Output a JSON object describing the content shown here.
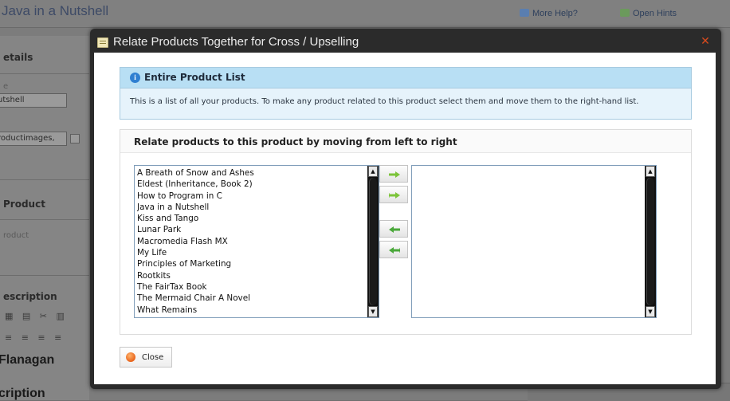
{
  "background": {
    "page_title": "Java in a Nutshell",
    "more_help": "More Help?",
    "open_hints": "Open Hints",
    "details_heading": "etails",
    "field_label_1": "e",
    "field_value_1": "utshell",
    "field_value_2": "roductimages,",
    "product_heading": "Product",
    "product_text": "roduct",
    "description_heading": "escription",
    "author_text": "Flanagan",
    "description_text": "cription"
  },
  "modal": {
    "title": "Relate Products Together for Cross / Upselling",
    "info": {
      "title": "Entire Product List",
      "text": "This is a list of all your products. To make any product related to this product select them and move them to the right-hand list."
    },
    "relate": {
      "title": "Relate products to this product by moving from left to right",
      "available_products": [
        "A Breath of Snow and Ashes",
        "Eldest (Inheritance, Book 2)",
        "How to Program in C",
        "Java in a Nutshell",
        "Kiss and Tango",
        "Lunar Park",
        "Macromedia Flash MX",
        "My Life",
        "Principles of Marketing",
        "Rootkits",
        "The FairTax Book",
        "The Mermaid Chair A Novel",
        "What Remains"
      ],
      "related_products": []
    },
    "close_label": "Close"
  },
  "colors": {
    "move_right_arrow": "#7cc43a",
    "move_left_arrow": "#4aa83a",
    "info_header": "#b8dff4",
    "close_icon": "#e8631b"
  },
  "icons": {
    "modal": "window-icon",
    "info": "info-icon",
    "close": "close-icon",
    "move_one_right": "arrow-right-icon",
    "move_all_right": "double-arrow-right-icon",
    "move_one_left": "arrow-left-icon",
    "move_all_left": "double-arrow-left-icon"
  }
}
